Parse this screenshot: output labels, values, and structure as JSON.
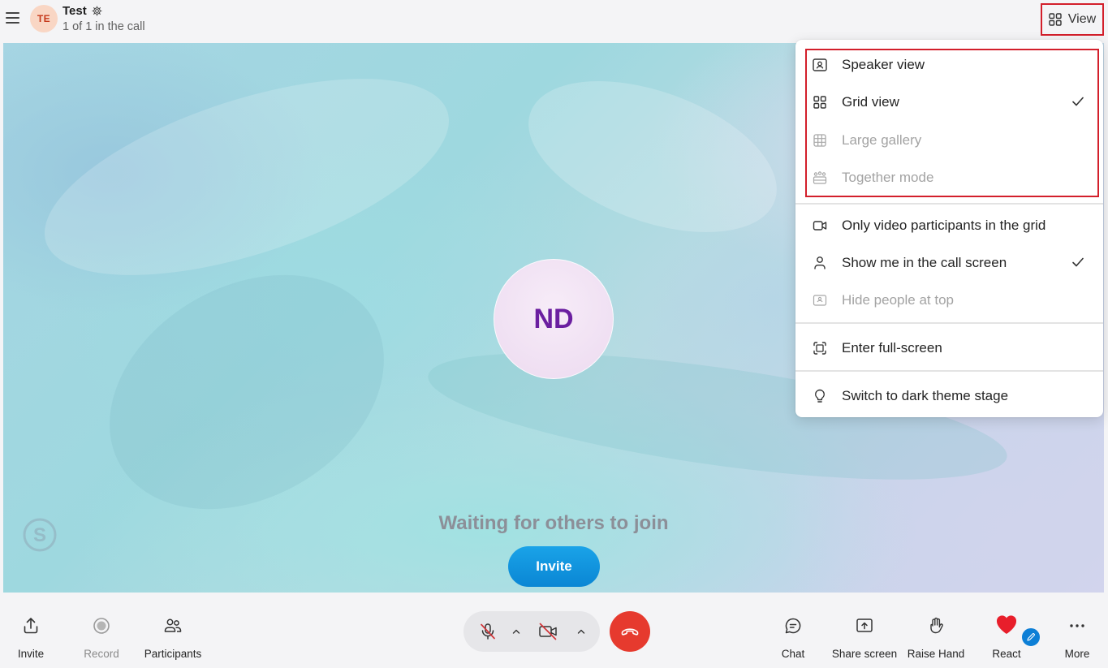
{
  "header": {
    "avatar_initials": "TE",
    "title": "Test",
    "subtitle": "1 of 1 in the call",
    "view_label": "View"
  },
  "stage": {
    "participant_initials": "ND",
    "waiting_text": "Waiting for others to join",
    "invite_label": "Invite"
  },
  "view_menu": {
    "items": [
      {
        "label": "Speaker view",
        "icon": "speaker-view-icon",
        "checked": false,
        "disabled": false
      },
      {
        "label": "Grid view",
        "icon": "grid-view-icon",
        "checked": true,
        "disabled": false
      },
      {
        "label": "Large gallery",
        "icon": "large-gallery-icon",
        "checked": false,
        "disabled": true
      },
      {
        "label": "Together mode",
        "icon": "together-mode-icon",
        "checked": false,
        "disabled": true
      },
      {
        "label": "Only video participants in the grid",
        "icon": "video-camera-icon",
        "checked": false,
        "disabled": false
      },
      {
        "label": "Show me in the call screen",
        "icon": "person-icon",
        "checked": true,
        "disabled": false
      },
      {
        "label": "Hide people at top",
        "icon": "hide-people-icon",
        "checked": false,
        "disabled": true
      },
      {
        "label": "Enter full-screen",
        "icon": "fullscreen-icon",
        "checked": false,
        "disabled": false
      },
      {
        "label": "Switch to dark theme stage",
        "icon": "lightbulb-icon",
        "checked": false,
        "disabled": false
      }
    ]
  },
  "toolbar": {
    "invite": "Invite",
    "record": "Record",
    "participants": "Participants",
    "chat": "Chat",
    "share_screen": "Share screen",
    "raise_hand": "Raise Hand",
    "react": "React",
    "more": "More"
  },
  "colors": {
    "accent_blue": "#0a86d4",
    "end_call_red": "#e63a2e",
    "highlight_red": "#d31f2b",
    "avatar_purple": "#6b1fa0"
  }
}
